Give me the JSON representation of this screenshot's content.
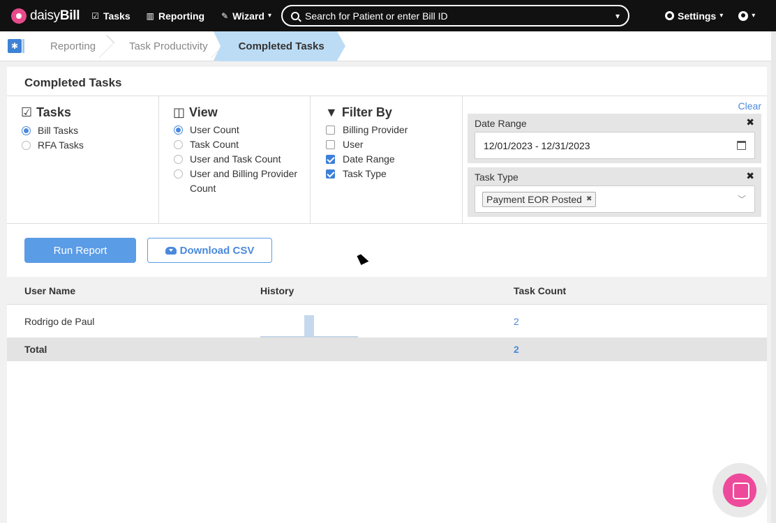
{
  "topnav": {
    "logo_prefix": "daisy",
    "logo_suffix": "Bill",
    "tasks_label": "Tasks",
    "reporting_label": "Reporting",
    "wizard_label": "Wizard",
    "search_placeholder": "Search for Patient or enter Bill ID",
    "settings_label": "Settings"
  },
  "breadcrumb": {
    "items": [
      "Reporting",
      "Task Productivity",
      "Completed Tasks"
    ]
  },
  "page": {
    "title": "Completed Tasks"
  },
  "tasks_section": {
    "heading": "Tasks",
    "options": [
      {
        "label": "Bill Tasks",
        "selected": true
      },
      {
        "label": "RFA Tasks",
        "selected": false
      }
    ]
  },
  "view_section": {
    "heading": "View",
    "options": [
      {
        "label": "User Count",
        "selected": true
      },
      {
        "label": "Task Count",
        "selected": false
      },
      {
        "label": "User and Task Count",
        "selected": false
      },
      {
        "label": "User and Billing Provider Count",
        "selected": false
      }
    ]
  },
  "filter_section": {
    "heading": "Filter By",
    "options": [
      {
        "label": "Billing Provider",
        "checked": false
      },
      {
        "label": "User",
        "checked": false
      },
      {
        "label": "Date Range",
        "checked": true
      },
      {
        "label": "Task Type",
        "checked": true
      }
    ]
  },
  "filters": {
    "clear_label": "Clear",
    "date_range": {
      "label": "Date Range",
      "value": "12/01/2023 - 12/31/2023"
    },
    "task_type": {
      "label": "Task Type",
      "tag": "Payment EOR Posted"
    }
  },
  "actions": {
    "run_report": "Run Report",
    "download_csv": "Download CSV"
  },
  "table": {
    "columns": [
      "User Name",
      "History",
      "Task Count"
    ],
    "rows": [
      {
        "user_name": "Rodrigo de Paul",
        "task_count": "2"
      }
    ],
    "total": {
      "label": "Total",
      "task_count": "2"
    }
  },
  "colors": {
    "accent": "#4a89dc",
    "brand": "#e74a8b",
    "breadcrumb_active": "#bcdcf5"
  }
}
